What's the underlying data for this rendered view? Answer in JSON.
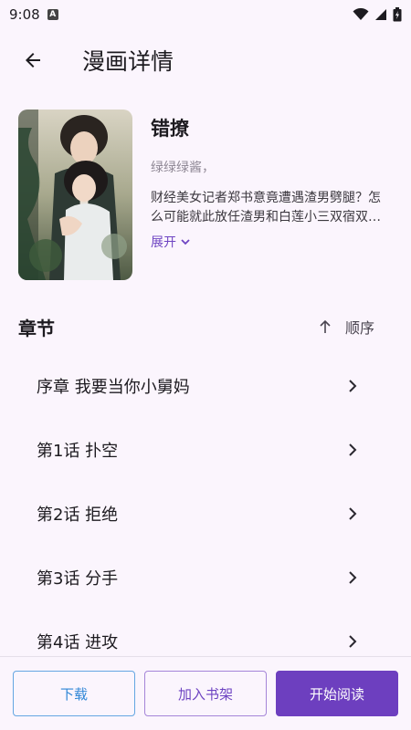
{
  "status_bar": {
    "time": "9:08",
    "a_icon_label": "A"
  },
  "app_bar": {
    "title": "漫画详情"
  },
  "comic": {
    "title": "错撩",
    "author": "绿绿绿酱，",
    "description": "财经美女记者郑书意竟遭遇渣男劈腿？怎么可能就此放任渣男和白莲小三双宿双飞，",
    "expand_label": "展开"
  },
  "chapters": {
    "title": "章节",
    "sort_label": "顺序",
    "items": [
      {
        "label": "序章 我要当你小舅妈"
      },
      {
        "label": "第1话 扑空"
      },
      {
        "label": "第2话 拒绝"
      },
      {
        "label": "第3话 分手"
      },
      {
        "label": "第4话 进攻"
      }
    ]
  },
  "actions": {
    "download_label": "下载",
    "add_shelf_label": "加入书架",
    "read_label": "开始阅读"
  },
  "colors": {
    "background": "#fbf5fd",
    "accent": "#6d3fbf",
    "download_blue": "#2f86d6"
  }
}
